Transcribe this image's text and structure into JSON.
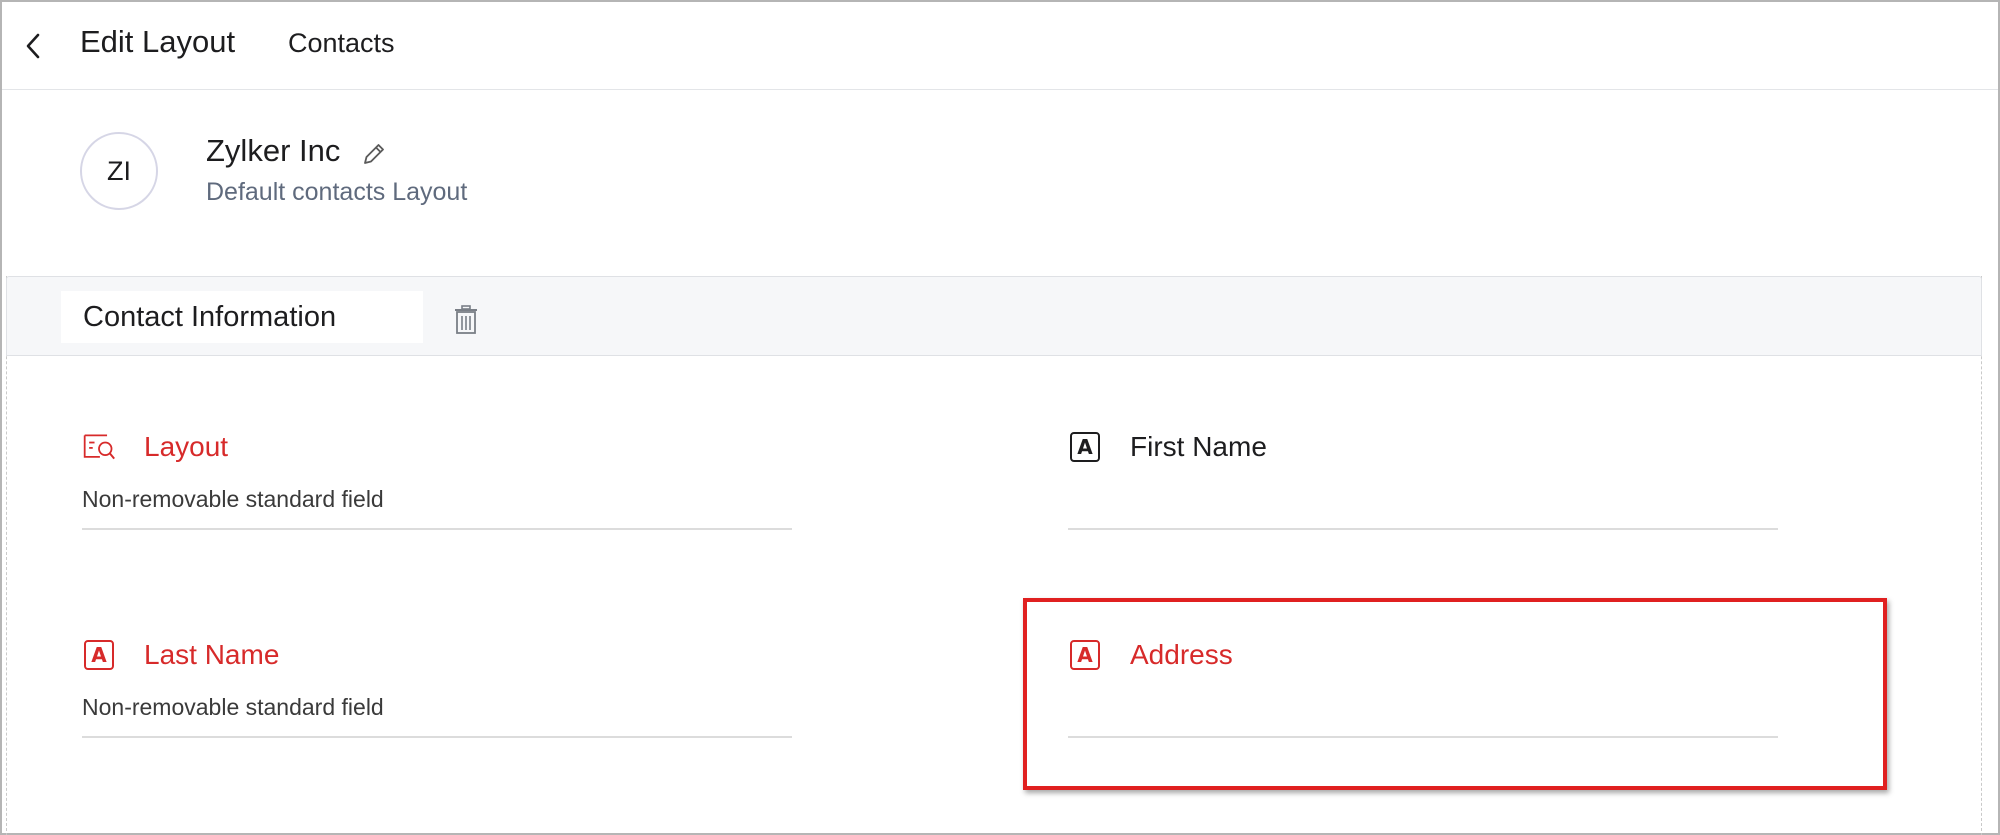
{
  "header": {
    "title": "Edit Layout",
    "module": "Contacts"
  },
  "layout": {
    "avatar_initials": "ZI",
    "name": "Zylker Inc",
    "description": "Default contacts Layout"
  },
  "section": {
    "title": "Contact Information"
  },
  "fields": {
    "layout": {
      "label": "Layout",
      "hint": "Non-removable standard field"
    },
    "first_name": {
      "label": "First Name"
    },
    "last_name": {
      "label": "Last Name",
      "hint": "Non-removable standard field",
      "icon_letter": "A"
    },
    "address": {
      "label": "Address",
      "icon_letter": "A"
    },
    "first_name_icon_letter": "A"
  },
  "colors": {
    "accent_red": "#d72a2a",
    "highlight": "#e02020"
  }
}
